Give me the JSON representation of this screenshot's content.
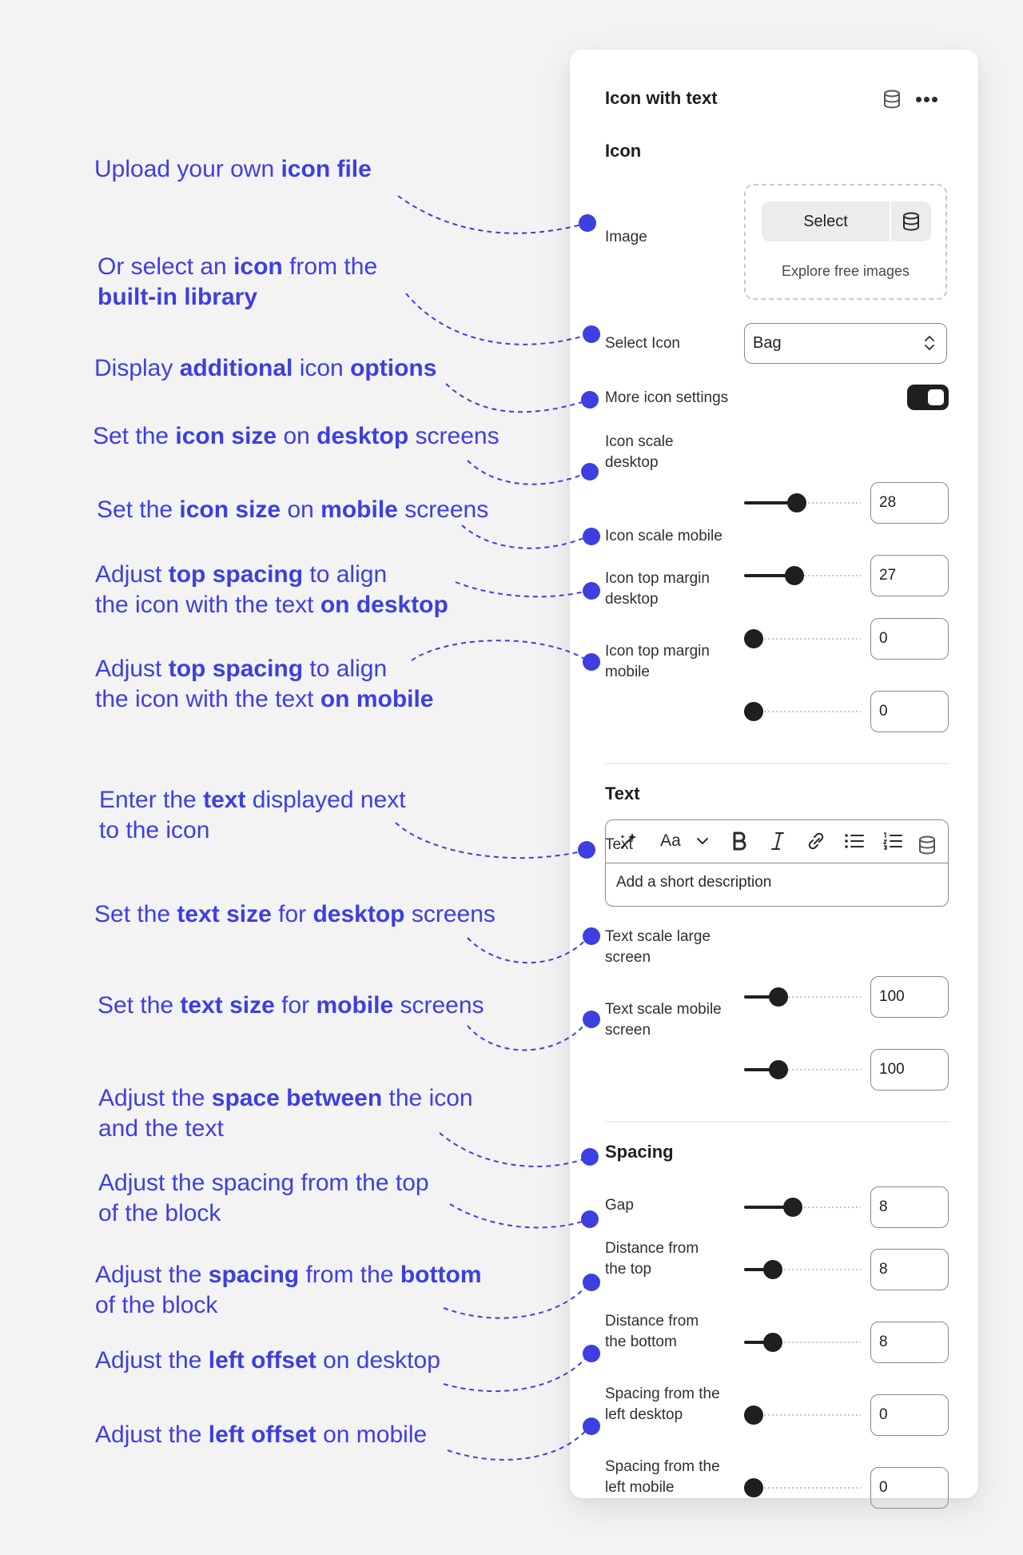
{
  "panel": {
    "title": "Icon with text",
    "icon_section": {
      "title": "Icon",
      "image_label": "Image",
      "select_button": "Select",
      "explore_link": "Explore free images",
      "select_icon_label": "Select Icon",
      "select_icon_value": "Bag",
      "more_settings_label": "More icon settings",
      "more_settings_on": true,
      "scale_desktop": {
        "label_1": "Icon scale",
        "label_2": "desktop",
        "value": "28"
      },
      "scale_mobile": {
        "label": "Icon scale mobile",
        "value": "27"
      },
      "top_margin_desktop": {
        "label_1": "Icon top margin",
        "label_2": "desktop",
        "value": "0"
      },
      "top_margin_mobile": {
        "label_1": "Icon top margin",
        "label_2": "mobile",
        "value": "0"
      }
    },
    "text_section": {
      "title": "Text",
      "text_label": "Text",
      "font_button": "Aa",
      "placeholder": "Add a short description",
      "scale_large": {
        "label_1": "Text scale large",
        "label_2": "screen",
        "value": "100"
      },
      "scale_mobile": {
        "label_1": "Text scale mobile",
        "label_2": "screen",
        "value": "100"
      }
    },
    "spacing_section": {
      "title": "Spacing",
      "gap": {
        "label": "Gap",
        "value": "8"
      },
      "top": {
        "label_1": "Distance from",
        "label_2": "the top",
        "value": "8"
      },
      "bottom": {
        "label_1": "Distance from",
        "label_2": "the bottom",
        "value": "8"
      },
      "left_desktop": {
        "label_1": "Spacing from the",
        "label_2": "left desktop",
        "value": "0"
      },
      "left_mobile": {
        "label_1": "Spacing from the",
        "label_2": "left mobile",
        "value": "0"
      }
    }
  },
  "annotations": [
    {
      "lines": [
        [
          {
            "t": "Upload your own "
          },
          {
            "t": "icon file",
            "b": true
          }
        ]
      ]
    },
    {
      "lines": [
        [
          {
            "t": "Or select an "
          },
          {
            "t": "icon",
            "b": true
          },
          {
            "t": " from the"
          }
        ],
        [
          {
            "t": "built-in library",
            "b": true
          }
        ]
      ]
    },
    {
      "lines": [
        [
          {
            "t": "Display "
          },
          {
            "t": "additional",
            "b": true
          },
          {
            "t": " icon "
          },
          {
            "t": "options",
            "b": true
          }
        ]
      ]
    },
    {
      "lines": [
        [
          {
            "t": "Set the "
          },
          {
            "t": "icon size",
            "b": true
          },
          {
            "t": " on "
          },
          {
            "t": "desktop",
            "b": true
          },
          {
            "t": " screens"
          }
        ]
      ]
    },
    {
      "lines": [
        [
          {
            "t": "Set the "
          },
          {
            "t": "icon size",
            "b": true
          },
          {
            "t": " on "
          },
          {
            "t": "mobile",
            "b": true
          },
          {
            "t": " screens"
          }
        ]
      ]
    },
    {
      "lines": [
        [
          {
            "t": "Adjust "
          },
          {
            "t": "top spacing",
            "b": true
          },
          {
            "t": " to align"
          }
        ],
        [
          {
            "t": "the icon with the text "
          },
          {
            "t": "on desktop",
            "b": true
          }
        ]
      ]
    },
    {
      "lines": [
        [
          {
            "t": "Adjust "
          },
          {
            "t": "top spacing",
            "b": true
          },
          {
            "t": " to align"
          }
        ],
        [
          {
            "t": "the icon with the text "
          },
          {
            "t": "on mobile",
            "b": true
          }
        ]
      ]
    },
    {
      "lines": [
        [
          {
            "t": "Enter the "
          },
          {
            "t": "text",
            "b": true
          },
          {
            "t": " displayed next"
          }
        ],
        [
          {
            "t": "to the icon"
          }
        ]
      ]
    },
    {
      "lines": [
        [
          {
            "t": "Set the "
          },
          {
            "t": "text size",
            "b": true
          },
          {
            "t": " for "
          },
          {
            "t": "desktop",
            "b": true
          },
          {
            "t": " screens"
          }
        ]
      ]
    },
    {
      "lines": [
        [
          {
            "t": "Set the "
          },
          {
            "t": "text size",
            "b": true
          },
          {
            "t": " for "
          },
          {
            "t": "mobile",
            "b": true
          },
          {
            "t": " screens"
          }
        ]
      ]
    },
    {
      "lines": [
        [
          {
            "t": "Adjust the "
          },
          {
            "t": "space between",
            "b": true
          },
          {
            "t": " the icon"
          }
        ],
        [
          {
            "t": "and the text"
          }
        ]
      ]
    },
    {
      "lines": [
        [
          {
            "t": "Adjust the spacing from the top"
          }
        ],
        [
          {
            "t": "of the block"
          }
        ]
      ]
    },
    {
      "lines": [
        [
          {
            "t": "Adjust the "
          },
          {
            "t": "spacing",
            "b": true
          },
          {
            "t": " from the "
          },
          {
            "t": "bottom",
            "b": true
          }
        ],
        [
          {
            "t": "of the block"
          }
        ]
      ]
    },
    {
      "lines": [
        [
          {
            "t": "Adjust the "
          },
          {
            "t": "left offset",
            "b": true
          },
          {
            "t": " on desktop"
          }
        ]
      ]
    },
    {
      "lines": [
        [
          {
            "t": "Adjust the "
          },
          {
            "t": "left offset",
            "b": true
          },
          {
            "t": " on mobile"
          }
        ]
      ]
    }
  ],
  "sliders": [
    {
      "id": "icon-scale-desktop",
      "fraction": 0.44
    },
    {
      "id": "icon-scale-mobile",
      "fraction": 0.42
    },
    {
      "id": "icon-top-margin-desktop",
      "fraction": 0.0
    },
    {
      "id": "icon-top-margin-mobile",
      "fraction": 0.0
    },
    {
      "id": "text-scale-large",
      "fraction": 0.25
    },
    {
      "id": "text-scale-mobile",
      "fraction": 0.25
    },
    {
      "id": "gap",
      "fraction": 0.4
    },
    {
      "id": "distance-top",
      "fraction": 0.2
    },
    {
      "id": "distance-bottom",
      "fraction": 0.2
    },
    {
      "id": "left-desktop",
      "fraction": 0.0
    },
    {
      "id": "left-mobile",
      "fraction": 0.0
    }
  ],
  "colors": {
    "accent": "#3d3fe0",
    "control": "#1f1f1f"
  }
}
